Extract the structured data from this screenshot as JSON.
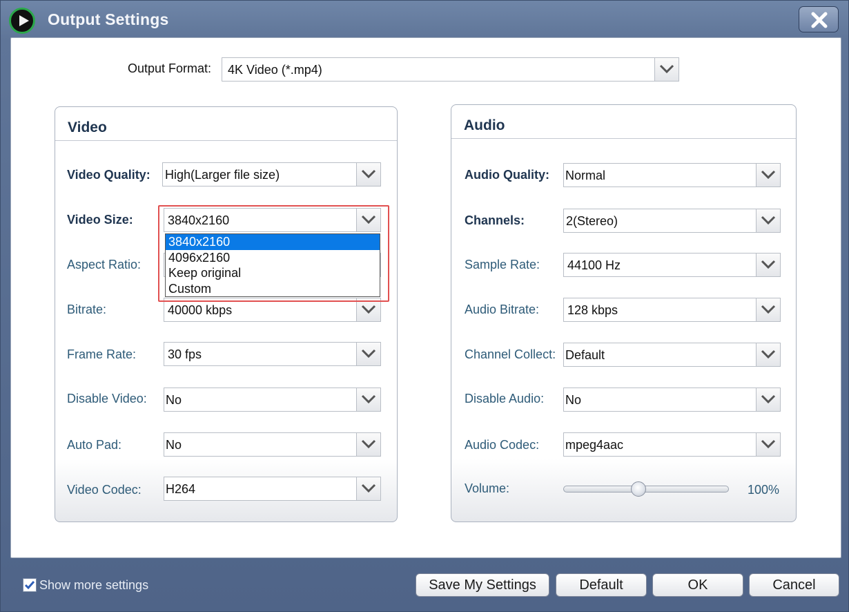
{
  "window": {
    "title": "Output Settings"
  },
  "output_format": {
    "label": "Output Format:",
    "value": "4K Video (*.mp4)"
  },
  "video": {
    "title": "Video",
    "quality": {
      "label": "Video Quality:",
      "value": "High(Larger file size)"
    },
    "size": {
      "label": "Video Size:",
      "value": "3840x2160",
      "options": [
        "3840x2160",
        "4096x2160",
        "Keep original",
        "Custom"
      ]
    },
    "aspect": {
      "label": "Aspect Ratio:"
    },
    "bitrate": {
      "label": "Bitrate:",
      "value": "40000 kbps"
    },
    "frame_rate": {
      "label": "Frame Rate:",
      "value": "30 fps"
    },
    "disable": {
      "label": "Disable Video:",
      "value": "No"
    },
    "auto_pad": {
      "label": "Auto Pad:",
      "value": "No"
    },
    "codec": {
      "label": "Video Codec:",
      "value": "H264"
    }
  },
  "audio": {
    "title": "Audio",
    "quality": {
      "label": "Audio Quality:",
      "value": "Normal"
    },
    "channels": {
      "label": "Channels:",
      "value": "2(Stereo)"
    },
    "sample_rate": {
      "label": "Sample Rate:",
      "value": "44100 Hz"
    },
    "bitrate": {
      "label": "Audio Bitrate:",
      "value": "128 kbps"
    },
    "channel_collect": {
      "label": "Channel Collect:",
      "value": "Default"
    },
    "disable": {
      "label": "Disable Audio:",
      "value": "No"
    },
    "codec": {
      "label": "Audio Codec:",
      "value": "mpeg4aac"
    },
    "volume": {
      "label": "Volume:",
      "value": "100%",
      "level": 0.45
    }
  },
  "footer": {
    "show_more": "Show more settings",
    "save": "Save My Settings",
    "default": "Default",
    "ok": "OK",
    "cancel": "Cancel"
  },
  "colors": {
    "selection": "#0a7ae6",
    "highlight": "#e15050",
    "title_bar": "#5f7598"
  }
}
